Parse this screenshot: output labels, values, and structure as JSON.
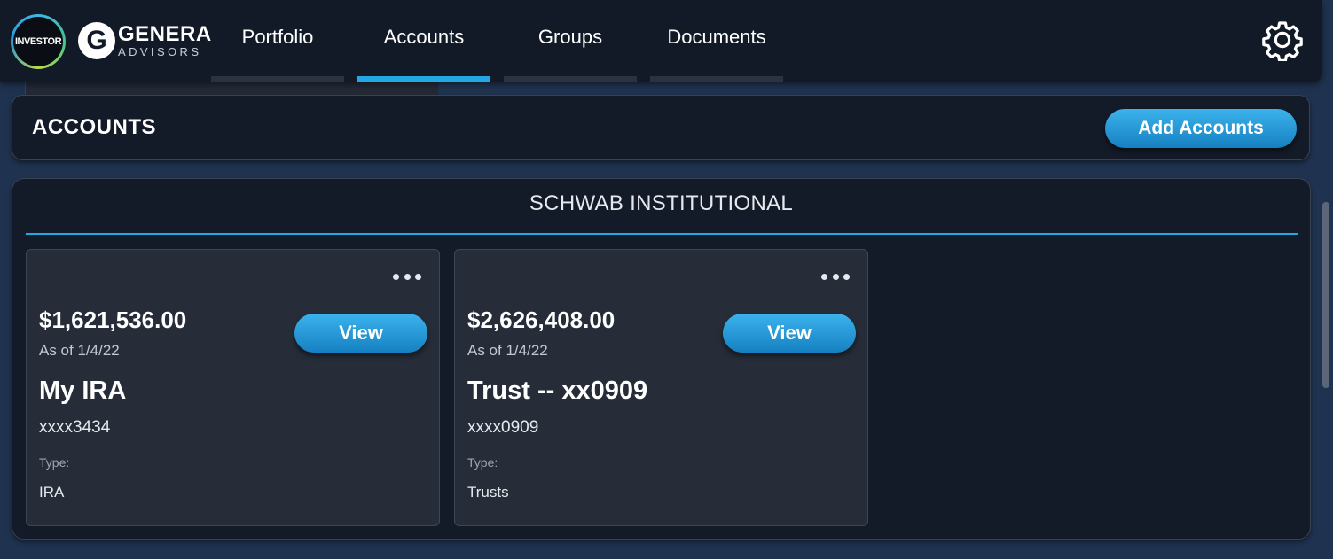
{
  "brand": {
    "investor_logo": "INVESTOR",
    "genera_letter": "G",
    "genera_name": "GENERA",
    "genera_sub": "ADVISORS"
  },
  "nav": {
    "tabs": [
      {
        "label": "Portfolio",
        "active": false
      },
      {
        "label": "Accounts",
        "active": true
      },
      {
        "label": "Groups",
        "active": false
      },
      {
        "label": "Documents",
        "active": false
      }
    ],
    "settings_icon": "gear-icon"
  },
  "accounts_header": {
    "title": "ACCOUNTS",
    "add_button": "Add Accounts"
  },
  "institution": {
    "name": "SCHWAB INSTITUTIONAL",
    "accounts": [
      {
        "balance": "$1,621,536.00",
        "as_of": "As of 1/4/22",
        "view_label": "View",
        "name": "My IRA",
        "number": "xxxx3434",
        "type_label": "Type:",
        "type": "IRA"
      },
      {
        "balance": "$2,626,408.00",
        "as_of": "As of 1/4/22",
        "view_label": "View",
        "name": "Trust -- xx0909",
        "number": "xxxx0909",
        "type_label": "Type:",
        "type": "Trusts"
      }
    ]
  },
  "colors": {
    "accent": "#22a8e2",
    "nav_bg": "#131a27",
    "page_bg": "#1f3350",
    "card_bg": "#262d39"
  }
}
